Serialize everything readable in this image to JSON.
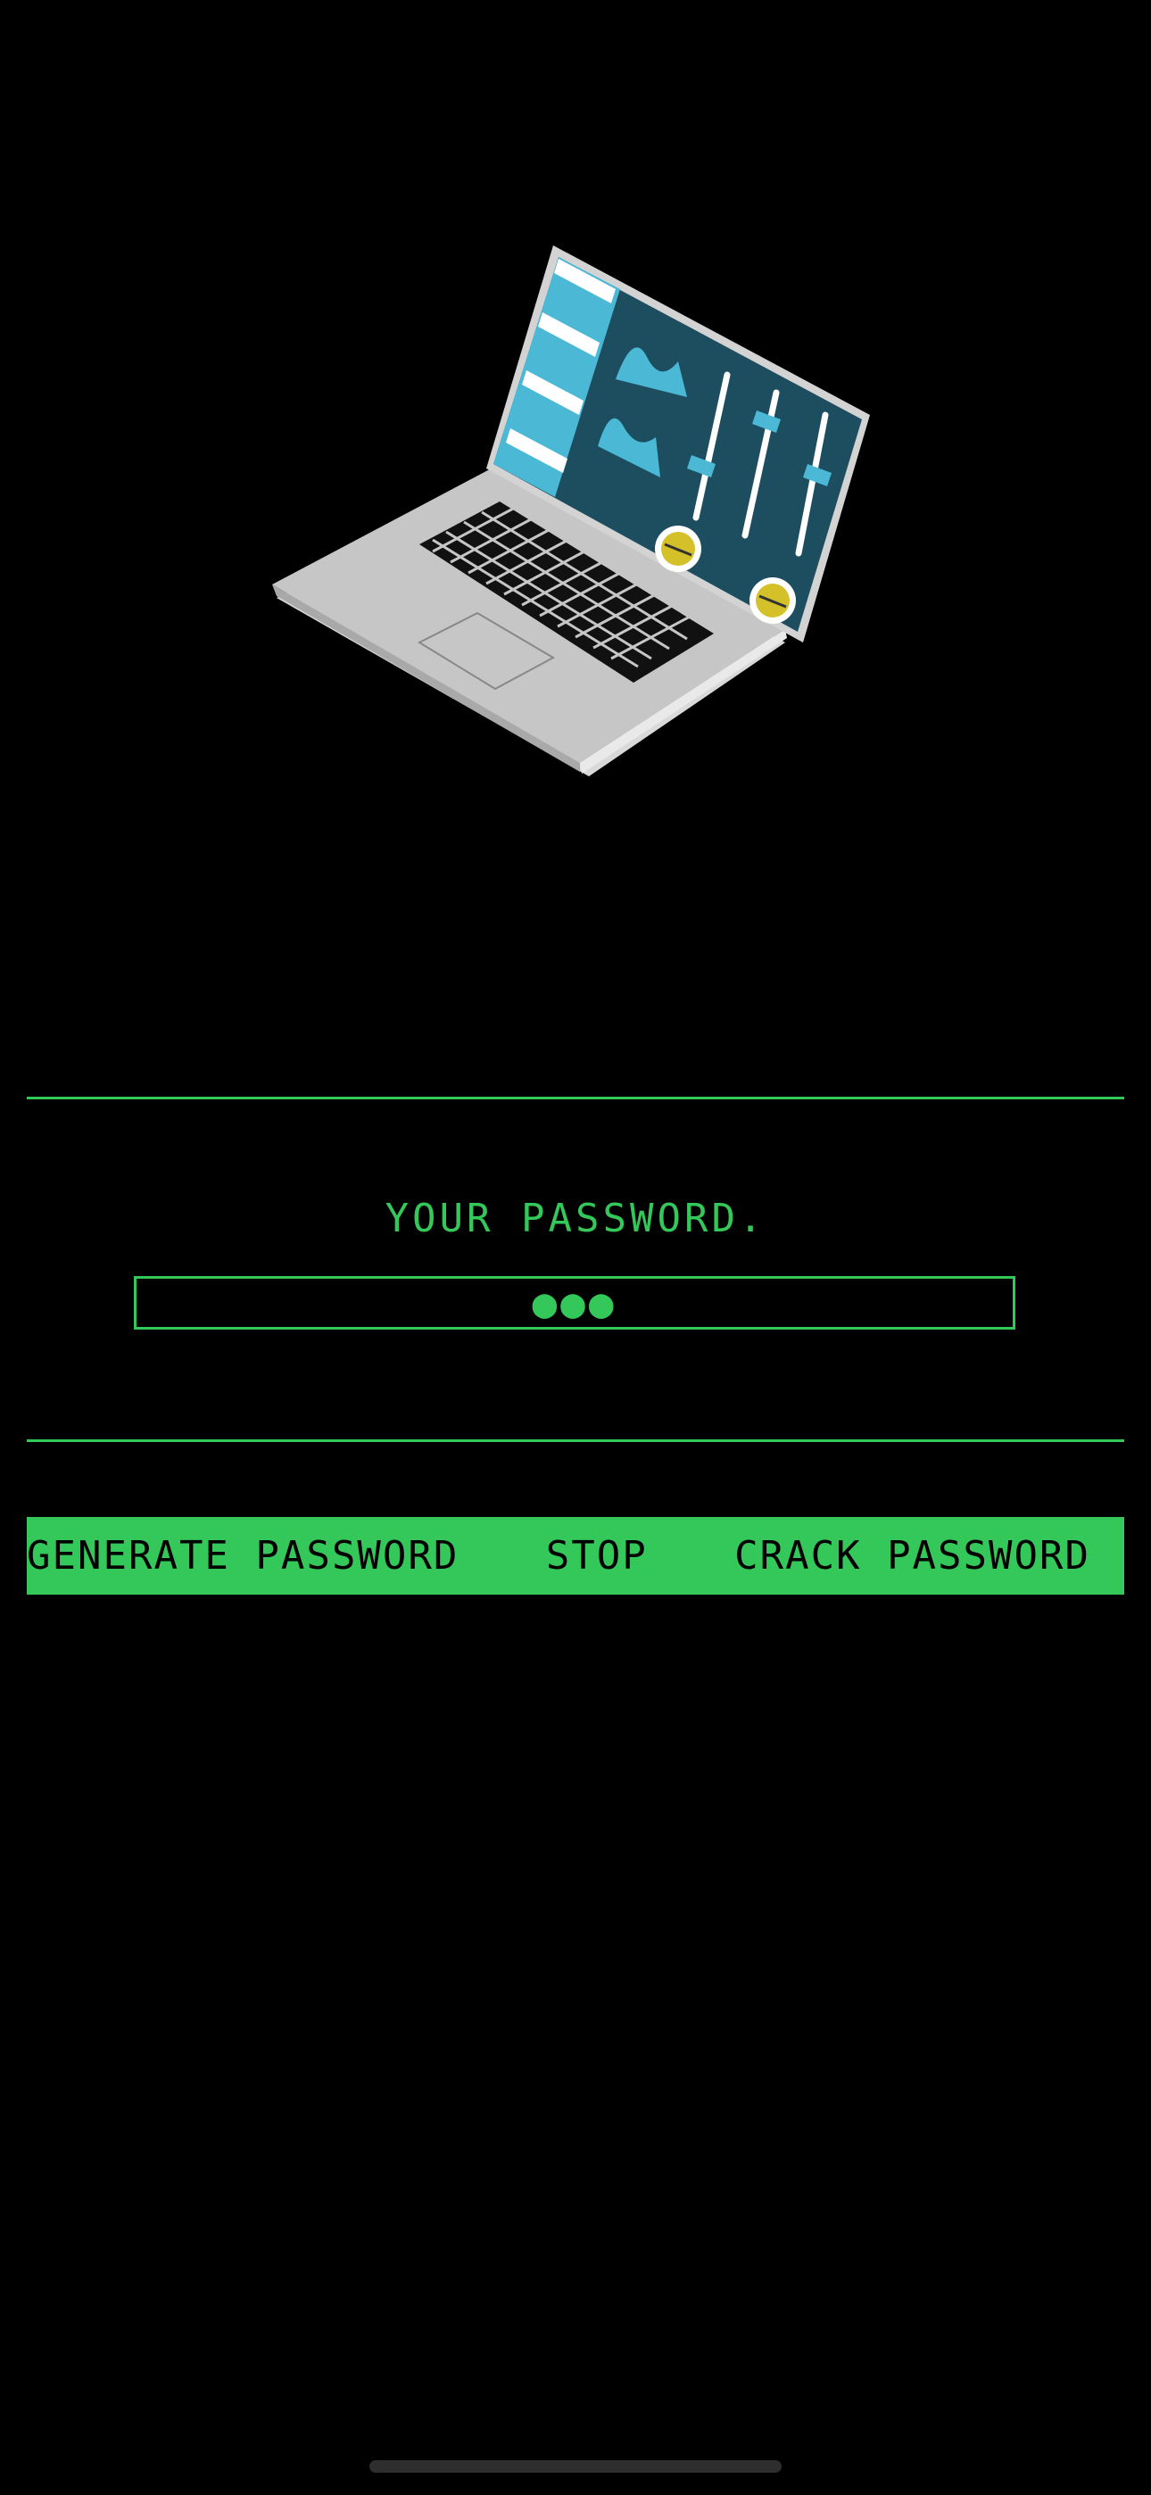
{
  "colors": {
    "accent": "#34C759",
    "background": "#000000",
    "button_text": "#000000",
    "home_indicator": "#2E2E2E"
  },
  "hero": {
    "icon": "laptop-dashboard-illustration"
  },
  "password": {
    "label": "YOUR PASSWORD.",
    "value": "●●●"
  },
  "actions": {
    "generate_label": "GENERATE PASSWORD",
    "stop_label": "STOP",
    "crack_label": "CRACK PASSWORD"
  }
}
